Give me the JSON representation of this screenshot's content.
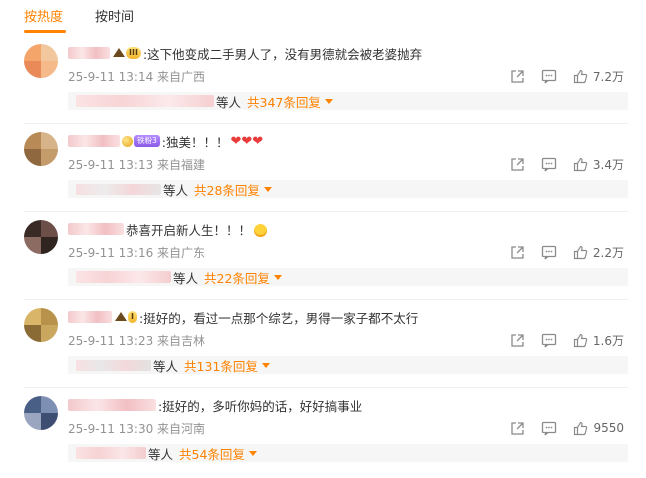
{
  "tabs": [
    {
      "label": "按热度",
      "active": true
    },
    {
      "label": "按时间",
      "active": false
    }
  ],
  "colors": {
    "accent": "#ff8200",
    "meta": "#939393",
    "heart": "#ea3b3b"
  },
  "icons": {
    "share": "share-icon",
    "comment": "comment-icon",
    "like": "like-icon"
  },
  "comments": [
    {
      "text": ":这下他变成二手男人了，没有男德就会被老婆抛弃",
      "badge": "III",
      "meta": "25-9-11 13:14 来自广西",
      "likes": "7.2万",
      "replies_suffix": "等人",
      "replies_link": "共347条回复"
    },
    {
      "text": ":独美！！！",
      "badge": "铁粉3",
      "meta": "25-9-11 13:13 来自福建",
      "likes": "3.4万",
      "replies_suffix": "等人",
      "replies_link": "共28条回复"
    },
    {
      "text": "恭喜开启新人生！！！",
      "meta": "25-9-11 13:16 来自广东",
      "likes": "2.2万",
      "replies_suffix": "等人",
      "replies_link": "共22条回复"
    },
    {
      "text": ":挺好的，看过一点那个综艺，男得一家子都不太行",
      "badge": "I",
      "meta": "25-9-11 13:23 来自吉林",
      "likes": "1.6万",
      "replies_suffix": "等人",
      "replies_link": "共131条回复"
    },
    {
      "text": ":挺好的，多听你妈的话，好好搞事业",
      "meta": "25-9-11 13:30 来自河南",
      "likes": "9550",
      "replies_suffix": "等人",
      "replies_link": "共54条回复"
    }
  ]
}
